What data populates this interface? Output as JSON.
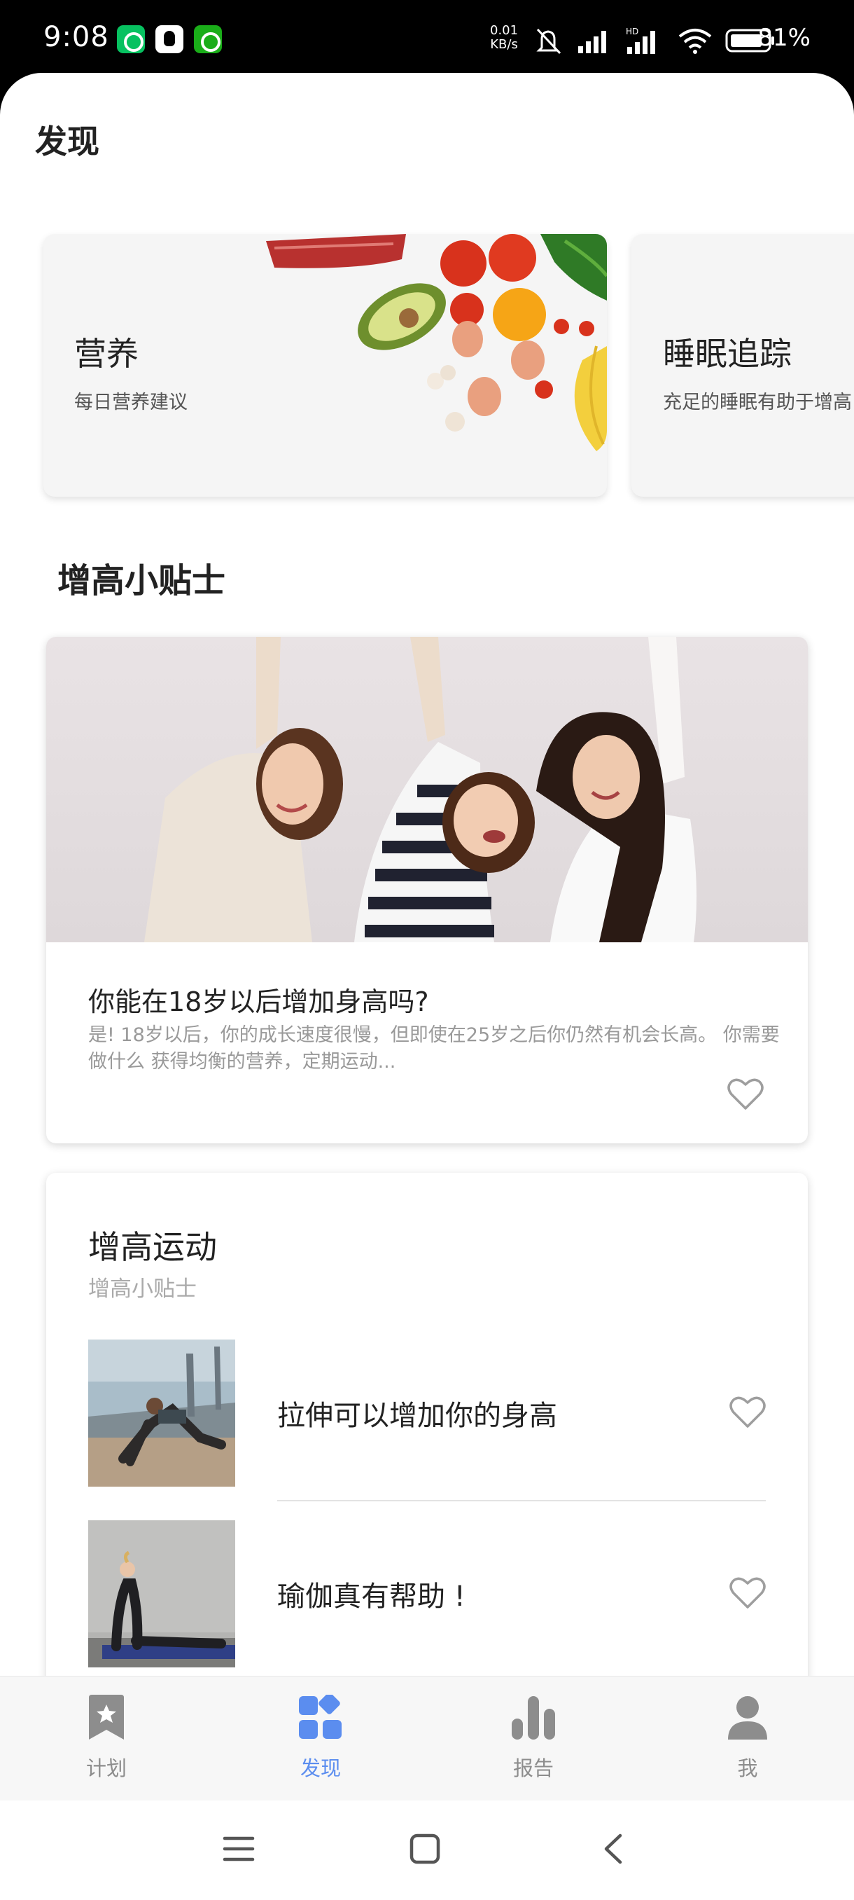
{
  "status_bar": {
    "time": "9:08",
    "net_speed_value": "0.01",
    "net_speed_unit": "KB/s",
    "battery": "81%",
    "icons": [
      "wechat-icon",
      "qq-icon",
      "green-app-icon",
      "mute-icon",
      "signal-icon",
      "hd-signal-icon",
      "wifi-icon",
      "battery-icon"
    ]
  },
  "page": {
    "title": "发现"
  },
  "features": [
    {
      "title": "营养",
      "subtitle": "每日营养建议"
    },
    {
      "title": "睡眠追踪",
      "subtitle": "充足的睡眠有助于增高"
    }
  ],
  "tips": {
    "section_title": "增高小贴士",
    "article": {
      "title": "你能在18岁以后增加身高吗?",
      "body": "是! 18岁以后，你的成长速度很慢，但即使在25岁之后你仍然有机会长高。 你需要做什么 获得均衡的营养，定期运动..."
    }
  },
  "exercise": {
    "title": "增高运动",
    "subtitle": "增高小贴士",
    "items": [
      {
        "label": "拉伸可以增加你的身高"
      },
      {
        "label": "瑜伽真有帮助 !"
      }
    ]
  },
  "bottom_nav": {
    "items": [
      {
        "label": "计划",
        "icon": "bookmark-star-icon"
      },
      {
        "label": "发现",
        "icon": "discover-grid-icon",
        "active": true
      },
      {
        "label": "报告",
        "icon": "bar-chart-icon"
      },
      {
        "label": "我",
        "icon": "person-icon"
      }
    ]
  },
  "colors": {
    "accent": "#5b8def",
    "inactive": "#8d8d8d",
    "heart_outline": "#9e9e9e"
  },
  "system_nav": {
    "icons": [
      "menu-icon",
      "home-icon",
      "back-icon"
    ]
  }
}
